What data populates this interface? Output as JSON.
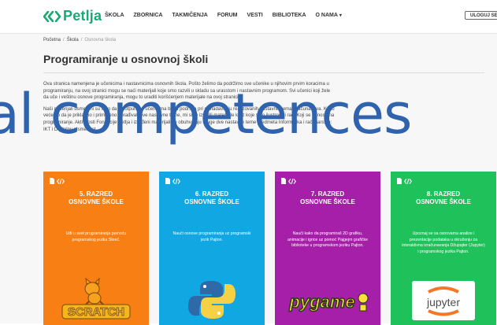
{
  "header": {
    "logo_text": "Petlja",
    "nav": [
      "ŠKOLA",
      "ZBORNICA",
      "TAKMIČENJA",
      "FORUM",
      "VESTI",
      "BIBLIOTEKA",
      "O NAMA"
    ],
    "login_label": "ULOGUJ SE"
  },
  "breadcrumb": {
    "home": "Početna",
    "level2": "Škola",
    "current": "Osnovna škola"
  },
  "page": {
    "title": "Programiranje u osnovnoj školi",
    "intro": [
      "Ova stranica namenjena je učenicima i nastavnicima osnovnih škola. Pošto želimo da podržimo sve učenike u njihovim prvim koracima u programiranju, na ovoj stranici mogu se naći materijali koje smo razvili u skladu sa urasstom i nastavnim programom. Svi učenici koji žele da uče i veštinu osnove programiranja, mogu to uraditi korišćenjem materijale na ovoj stranici.",
      "Naši materijali usmereni su tako da u potpunosti učenicima budu podrška pri savladavanju realizovanih nastavnih tema. Računarstva. Kako većemo da je prikladno i primereno obrađivati ove nastavne teme, mi smo izradili materijale kroz koje smo ilustrovali rad. Koji se odnose na programiranje. Aktivnosti Fondacije Petlja i izrađeni materijali ne obuhvataju druge dve nastavne teme predmeta Informatika i računarstvo: IKT i Digitalnu pismenost."
    ]
  },
  "overlay_text": "al competences",
  "cards": [
    {
      "grade": "5. RAZRED",
      "school": "OSNOVNE ŠKOLE",
      "desc": "Uđi u svet programiranja pomoću programskog jezika Skreč.",
      "art_label": "SCRATCH",
      "color": "#f77f14"
    },
    {
      "grade": "6. RAZRED",
      "school": "OSNOVNE ŠKOLE",
      "desc": "Nauči osnove programiranja uz programski jezik Pajton.",
      "art_label": "",
      "color": "#10a7e3"
    },
    {
      "grade": "7. RAZRED",
      "school": "OSNOVNE ŠKOLE",
      "desc": "Nauči kako da programiraš 2D grafiku, animacije i igrice uz pomoć Pajgejm grafičke biblioteke u programskom jeziku Pajton.",
      "art_label": "pygame",
      "color": "#a61fa8"
    },
    {
      "grade": "8. RAZRED",
      "school": "OSNOVNE ŠKOLE",
      "desc": "Upoznaj se sa osnovama analize i prezentacije podataka u okruženju za interaktivna izračunavanja Džupajter (Jupyter) i programskog jezika Pajton.",
      "art_label": "jupyter",
      "color": "#1fc25a"
    }
  ],
  "colors": {
    "brand": "#19a974",
    "overlay": "#2f63ae"
  }
}
